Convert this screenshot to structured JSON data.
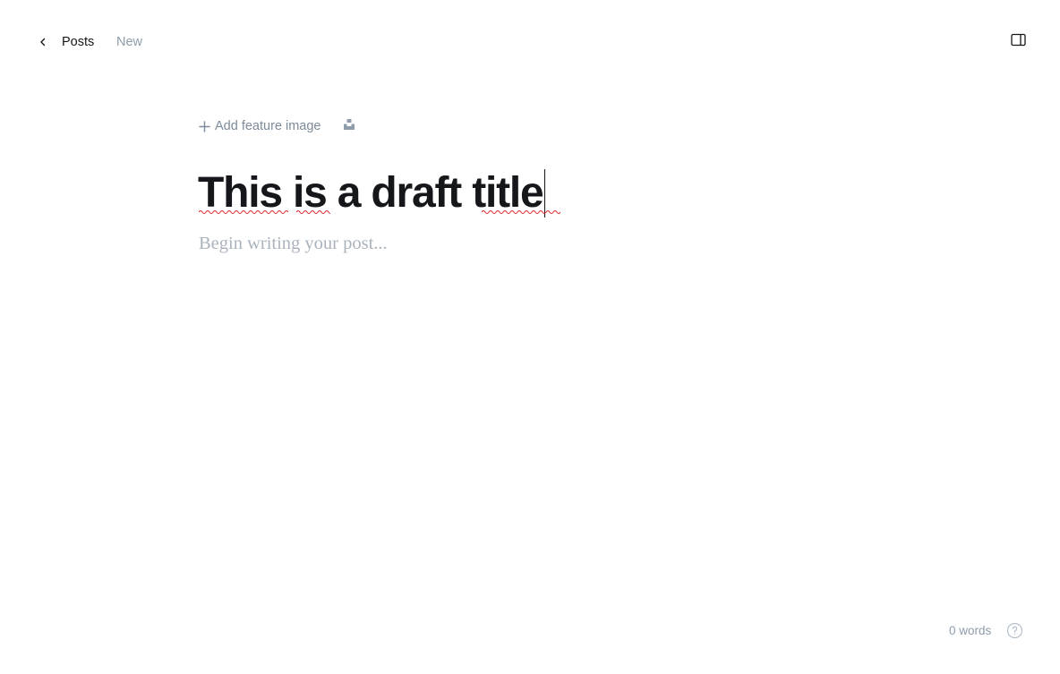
{
  "header": {
    "back_label": "Posts",
    "status": "New",
    "back_icon": "chevron-left-icon",
    "settings_icon": "sidebar-panel-icon"
  },
  "editor": {
    "feature_image_label": "Add feature image",
    "title": "This is a draft title",
    "body_placeholder": "Begin writing your post...",
    "unsplash_icon": "unsplash-icon"
  },
  "footer": {
    "word_count": "0 words",
    "help_icon": "question-circle-icon"
  },
  "colors": {
    "text": "#15171a",
    "muted": "#8e9cac",
    "placeholder": "#aab3bd",
    "spellcheck": "#e0242d"
  }
}
